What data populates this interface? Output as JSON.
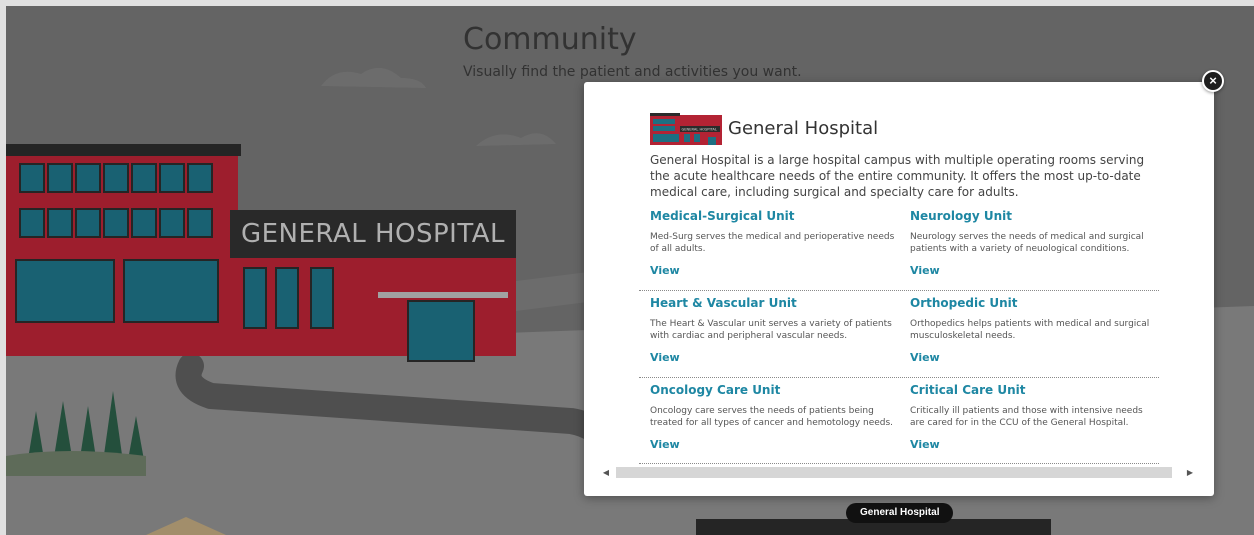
{
  "page": {
    "title": "Community",
    "subtitle": "Visually find the patient and activities you want."
  },
  "scene": {
    "building_sign": "GENERAL HOSPITAL",
    "tooltip": "General Hospital"
  },
  "modal": {
    "title": "General Hospital",
    "thumb_sign": "GENERAL HOSPITAL",
    "description": "General Hospital is a large hospital campus with multiple operating rooms serving the acute healthcare needs of the entire community. It offers the most up-to-date medical care, including surgical and specialty care for adults.",
    "close_label": "×",
    "units": [
      {
        "name": "Medical-Surgical Unit",
        "description": "Med-Surg serves the medical and perioperative needs of all adults.",
        "link": "View"
      },
      {
        "name": "Neurology Unit",
        "description": "Neurology serves the needs of medical and surgical patients with a variety of neuological conditions.",
        "link": "View"
      },
      {
        "name": "Heart & Vascular Unit",
        "description": "The Heart & Vascular unit serves a variety of patients with cardiac and peripheral vascular needs.",
        "link": "View"
      },
      {
        "name": "Orthopedic Unit",
        "description": "Orthopedics helps patients with medical and surgical musculoskeletal needs.",
        "link": "View"
      },
      {
        "name": "Oncology Care Unit",
        "description": "Oncology care serves the needs of patients being treated for all types of cancer and hemotology needs.",
        "link": "View"
      },
      {
        "name": "Critical Care Unit",
        "description": "Critically ill patients and those with intensive needs are cared for in the CCU of the General Hospital.",
        "link": "View"
      }
    ],
    "scrollbar": {
      "left_arrow": "◀",
      "right_arrow": "▶"
    }
  },
  "colors": {
    "accent": "#1e87a3",
    "hospital_red": "#b32334",
    "window_teal": "#1d6f82",
    "sky": "#737373",
    "ground": "#8c8c8c"
  }
}
